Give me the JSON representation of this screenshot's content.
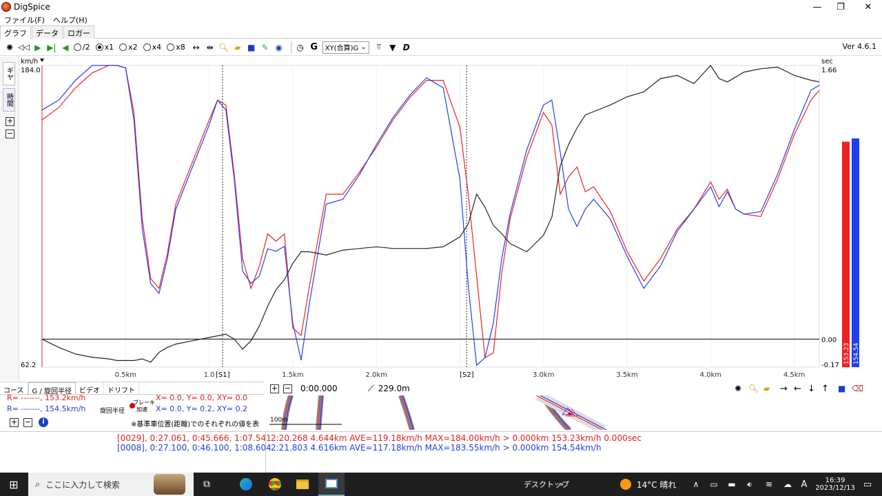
{
  "window": {
    "title": "DigSpice",
    "min": "—",
    "max": "❐",
    "close": "✕"
  },
  "menu": [
    "ファイル(F)",
    "ヘルプ(H)"
  ],
  "tabs": [
    "グラフ",
    "データ",
    "ロガー"
  ],
  "toolbar": {
    "speeds": [
      {
        "label": "/2",
        "selected": false
      },
      {
        "label": "x1",
        "selected": true
      },
      {
        "label": "x2",
        "selected": false
      },
      {
        "label": "x4",
        "selected": false
      },
      {
        "label": "x8",
        "selected": false
      }
    ],
    "g_label": "G",
    "mode_select": "XY(合算)G",
    "version": "Ver 4.6.1"
  },
  "side_tabs": [
    "ギヤ",
    "時間"
  ],
  "chart_data": {
    "type": "line",
    "left_unit": "km/h",
    "right_unit": "sec",
    "ylim_left": [
      62.2,
      184.0
    ],
    "ylim_right": [
      -0.17,
      1.66
    ],
    "y_left_ticks": [
      "184.0",
      "62.2"
    ],
    "y_right_ticks": [
      "1.66",
      "0.00",
      "-0.17"
    ],
    "xlim": [
      0.0,
      4.65
    ],
    "x_ticks": [
      {
        "x": 0.5,
        "label": "0.5km"
      },
      {
        "x": 1.0,
        "label": "1.0"
      },
      {
        "x": 1.5,
        "label": "1.5km"
      },
      {
        "x": 2.0,
        "label": "2.0km"
      },
      {
        "x": 2.5,
        "label": ""
      },
      {
        "x": 3.0,
        "label": "3.0km"
      },
      {
        "x": 3.5,
        "label": "3.5km"
      },
      {
        "x": 4.0,
        "label": "4.0km"
      },
      {
        "x": 4.5,
        "label": "4.5km"
      }
    ],
    "sectors": [
      {
        "x": 1.08,
        "label": "[S1]"
      },
      {
        "x": 2.54,
        "label": "[S2]"
      }
    ],
    "x": [
      0.0,
      0.1,
      0.2,
      0.3,
      0.4,
      0.45,
      0.5,
      0.55,
      0.6,
      0.65,
      0.7,
      0.75,
      0.8,
      0.9,
      1.0,
      1.05,
      1.1,
      1.15,
      1.2,
      1.25,
      1.3,
      1.35,
      1.4,
      1.45,
      1.5,
      1.55,
      1.6,
      1.7,
      1.8,
      1.9,
      2.0,
      2.1,
      2.2,
      2.3,
      2.4,
      2.5,
      2.55,
      2.6,
      2.65,
      2.7,
      2.75,
      2.8,
      2.9,
      3.0,
      3.05,
      3.1,
      3.15,
      3.2,
      3.25,
      3.3,
      3.4,
      3.5,
      3.6,
      3.7,
      3.8,
      3.9,
      4.0,
      4.05,
      4.1,
      4.15,
      4.2,
      4.3,
      4.4,
      4.5,
      4.6,
      4.65
    ],
    "series": [
      {
        "name": "153.23",
        "color": "#f02020",
        "values": [
          162,
          167,
          175,
          181,
          184,
          184,
          183,
          165,
          122,
          98,
          94,
          108,
          128,
          145,
          162,
          170,
          168,
          140,
          106,
          94,
          103,
          116,
          113,
          116,
          78,
          75,
          95,
          132,
          132,
          141,
          151,
          162,
          171,
          178,
          178,
          159,
          132,
          99,
          66,
          68,
          100,
          122,
          147,
          165,
          160,
          132,
          139,
          143,
          133,
          135,
          125,
          109,
          97,
          106,
          118,
          126,
          137,
          130,
          134,
          126,
          124,
          123,
          138,
          156,
          170,
          174
        ]
      },
      {
        "name": "154.54",
        "color": "#2040f0",
        "values": [
          166,
          170,
          178,
          184,
          184,
          184,
          183,
          162,
          118,
          96,
          92,
          106,
          126,
          143,
          160,
          170,
          166,
          138,
          101,
          96,
          99,
          110,
          109,
          111,
          80,
          65,
          88,
          128,
          130,
          140,
          152,
          163,
          172,
          179,
          175,
          138,
          95,
          63,
          66,
          80,
          106,
          124,
          150,
          168,
          170,
          149,
          126,
          119,
          126,
          130,
          122,
          107,
          94,
          103,
          117,
          126,
          135,
          127,
          133,
          126,
          124,
          125,
          140,
          158,
          174,
          176
        ]
      },
      {
        "name": "diff",
        "color": "#222222",
        "values": [
          0.0,
          -0.05,
          -0.09,
          -0.11,
          -0.12,
          -0.13,
          -0.13,
          -0.13,
          -0.12,
          -0.14,
          -0.08,
          -0.05,
          -0.03,
          -0.01,
          0.01,
          0.02,
          0.03,
          0.0,
          -0.06,
          -0.01,
          0.08,
          0.2,
          0.3,
          0.36,
          0.46,
          0.53,
          0.53,
          0.51,
          0.54,
          0.55,
          0.56,
          0.55,
          0.55,
          0.55,
          0.56,
          0.62,
          0.7,
          0.88,
          0.8,
          0.69,
          0.64,
          0.58,
          0.53,
          0.63,
          0.74,
          1.05,
          1.18,
          1.28,
          1.36,
          1.38,
          1.42,
          1.47,
          1.5,
          1.58,
          1.6,
          1.55,
          1.66,
          1.58,
          1.56,
          1.59,
          1.62,
          1.64,
          1.65,
          1.6,
          1.57,
          1.56
        ]
      }
    ],
    "bars": [
      {
        "label": "153.23",
        "value": 153.23,
        "color": "#f02020"
      },
      {
        "label": "154.54",
        "value": 154.54,
        "color": "#2040f0"
      }
    ]
  },
  "lower_tabs": [
    "コース",
    "G / 旋回半径",
    "ビデオ",
    "ドリフト"
  ],
  "gpanel": {
    "row1": "R= -------, 153.2km/h",
    "row1b": "X=  0.0, Y=  0.0, XY= 0.0",
    "row2": "R= -------, 154.5km/h",
    "row2b": "X=  0.0, Y=  0.2, XY= 0.2",
    "legend_a": "旋回半径",
    "legend_b": "ブレーキ",
    "legend_c": "加速",
    "note": "※基準車位置(距離)でのそれぞれの値を表示"
  },
  "map": {
    "time": "0:00.000",
    "distance": "229.0m",
    "scale": "100m"
  },
  "status": {
    "red_left": "[0029], 0:27.061, 0:45.666, 1:07.541",
    "blue_left": "[0008], 0:27.100, 0:46.100, 1:08.604",
    "red_right": "2:20.268 4.644km AVE=119.18km/h MAX=184.00km/h > 0.000km 153.23km/h 0.000sec",
    "blue_right": "2:21.803 4.616km AVE=117.18km/h MAX=183.55km/h > 0.000km 154.54km/h"
  },
  "taskbar": {
    "search_placeholder": "ここに入力して検索",
    "desktop": "デスクトップ",
    "weather": "14°C 晴れ",
    "time": "16:39",
    "date": "2023/12/13",
    "ime": "A"
  }
}
